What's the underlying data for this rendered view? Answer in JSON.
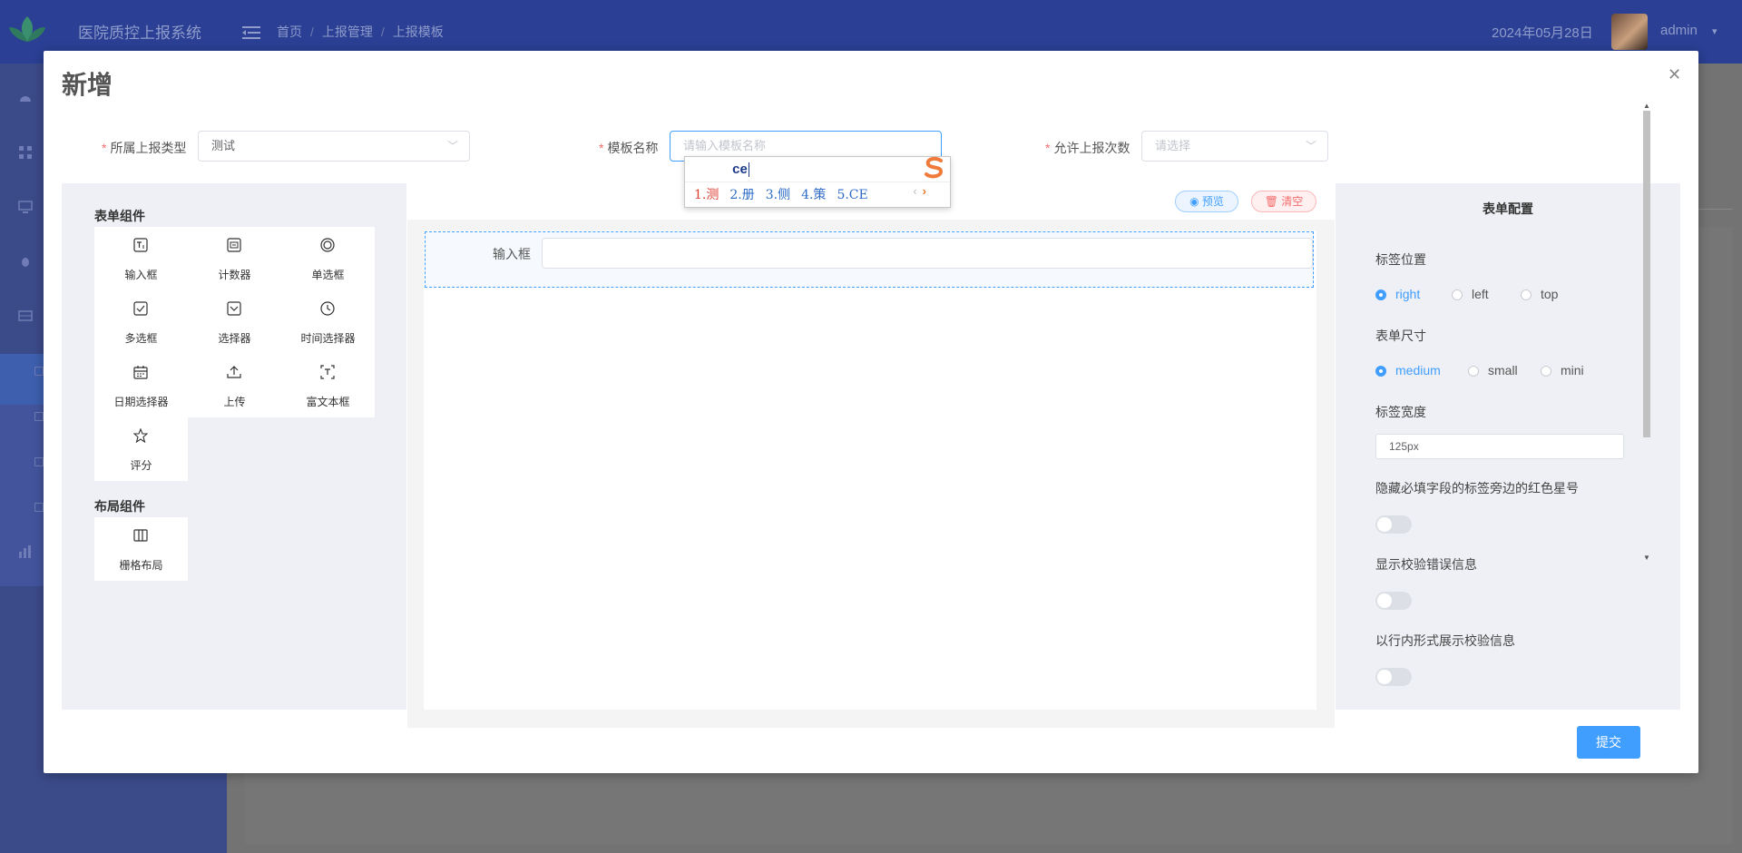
{
  "app": {
    "system_title": "医院质控上报系统",
    "breadcrumb": [
      "首页",
      "上报管理",
      "上报模板"
    ],
    "date": "2024年05月28日",
    "username": "admin"
  },
  "dialog": {
    "title": "新增",
    "close_icon": "close-icon",
    "fields": {
      "report_type": {
        "label": "所属上报类型",
        "value": "测试"
      },
      "template_name": {
        "label": "模板名称",
        "placeholder": "请输入模板名称"
      },
      "allowed_times": {
        "label": "允许上报次数",
        "placeholder": "请选择"
      }
    },
    "ime": {
      "composition": "ce",
      "candidates": [
        "1.测",
        "2.册",
        "3.侧",
        "4.策",
        "5.CE"
      ]
    },
    "left_panel": {
      "form_components_title": "表单组件",
      "form_components": [
        {
          "label": "输入框",
          "icon": "input-icon"
        },
        {
          "label": "计数器",
          "icon": "counter-icon"
        },
        {
          "label": "单选框",
          "icon": "radio-icon"
        },
        {
          "label": "多选框",
          "icon": "checkbox-icon"
        },
        {
          "label": "选择器",
          "icon": "select-icon"
        },
        {
          "label": "时间选择器",
          "icon": "clock-icon"
        },
        {
          "label": "日期选择器",
          "icon": "calendar-icon"
        },
        {
          "label": "上传",
          "icon": "upload-icon"
        },
        {
          "label": "富文本框",
          "icon": "rich-text-icon"
        },
        {
          "label": "评分",
          "icon": "star-icon"
        }
      ],
      "layout_components_title": "布局组件",
      "layout_components": [
        {
          "label": "栅格布局",
          "icon": "grid-icon"
        }
      ]
    },
    "center_panel": {
      "preview_label": "预览",
      "clear_label": "清空",
      "form_item_label": "输入框"
    },
    "right_panel": {
      "title": "表单配置",
      "label_position": {
        "label": "标签位置",
        "options": [
          "right",
          "left",
          "top"
        ],
        "selected": "right"
      },
      "form_size": {
        "label": "表单尺寸",
        "options": [
          "medium",
          "small",
          "mini"
        ],
        "selected": "medium"
      },
      "label_width": {
        "label": "标签宽度",
        "value": "125px"
      },
      "hide_required_asterisk": {
        "label": "隐藏必填字段的标签旁边的红色星号",
        "on": false
      },
      "show_validation_message": {
        "label": "显示校验错误信息",
        "on": false
      },
      "inline_validation_message": {
        "label": "以行内形式展示校验信息",
        "on": false
      }
    },
    "submit_label": "提交"
  },
  "colors": {
    "primary": "#409eff",
    "danger": "#f56c6c",
    "header": "#2b3f94",
    "required": "#f56c6c"
  }
}
